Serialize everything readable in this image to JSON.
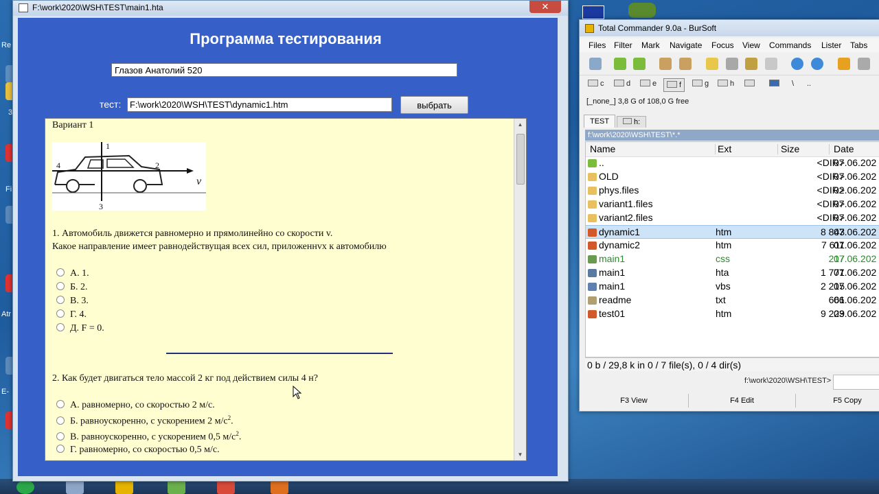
{
  "desktop": {
    "labels": [
      "Re",
      "3",
      "Fi",
      "Atr",
      "E-"
    ]
  },
  "hta_window": {
    "title": "F:\\work\\2020\\WSH\\TEST\\main1.hta",
    "close_label": "✕",
    "app_title": "Программа тестирования",
    "name_value": "Глазов Анатолий 520",
    "test_label": "тест:",
    "test_path": "F:\\work\\2020\\WSH\\TEST\\dynamic1.htm",
    "select_button": "выбрать",
    "test": {
      "variant": "Вариант 1",
      "q1_line1": "1.   Автомобиль движется равномерно и прямолинейно со скорости v.",
      "q1_line2": "Какое направление имеет равнодействущая всех сил, приложеннvх к автомобилю",
      "q1_options": [
        "А. 1.",
        "Б. 2.",
        "В. 3.",
        "Г. 4.",
        "Д. F = 0."
      ],
      "q2": "2.   Как будет двигаться тело массой 2 кг под действием силы 4 н?",
      "q2_options": [
        "А. равномерно, со скоростью 2 м/с.",
        "Б. равноускоренно, с ускорением 2 м/с",
        "В. равноускоренно, с ускорением 0,5 м/с",
        "Г. равномерно, со скоростью 0,5 м/с."
      ],
      "superscript": "2",
      "period": ".",
      "figure_labels": {
        "one": "1",
        "two": "2",
        "three": "3",
        "four": "4",
        "v": "v"
      }
    }
  },
  "total_commander": {
    "title": "Total Commander 9.0a - BurSoft",
    "menu": [
      "Files",
      "Filter",
      "Mark",
      "Navigate",
      "Focus",
      "View",
      "Commands",
      "Lister",
      "Tabs"
    ],
    "drives": [
      "c",
      "d",
      "e",
      "f",
      "g",
      "h",
      "\\",
      ".."
    ],
    "free_info": "[_none_]  3,8 G of 108,0 G free",
    "tabs": [
      "TEST",
      "h:"
    ],
    "path": "f:\\work\\2020\\WSH\\TEST\\*.*",
    "columns": [
      "Name",
      "Ext",
      "Size",
      "Date"
    ],
    "files": [
      {
        "name": "..",
        "ext": "",
        "size": "<DIR>",
        "date": "07.06.202"
      },
      {
        "name": "OLD",
        "ext": "",
        "size": "<DIR>",
        "date": "07.06.202"
      },
      {
        "name": "phys.files",
        "ext": "",
        "size": "<DIR>",
        "date": "02.06.202"
      },
      {
        "name": "variant1.files",
        "ext": "",
        "size": "<DIR>",
        "date": "07.06.202"
      },
      {
        "name": "variant2.files",
        "ext": "",
        "size": "<DIR>",
        "date": "07.06.202"
      },
      {
        "name": "dynamic1",
        "ext": "htm",
        "size": "8 843",
        "date": "07.06.202"
      },
      {
        "name": "dynamic2",
        "ext": "htm",
        "size": "7 611",
        "date": "07.06.202"
      },
      {
        "name": "main1",
        "ext": "css",
        "size": "217",
        "date": "07.06.202"
      },
      {
        "name": "main1",
        "ext": "hta",
        "size": "1 771",
        "date": "07.06.202"
      },
      {
        "name": "main1",
        "ext": "vbs",
        "size": "2 215",
        "date": "07.06.202"
      },
      {
        "name": "readme",
        "ext": "txt",
        "size": "661",
        "date": "06.06.202"
      },
      {
        "name": "test01",
        "ext": "htm",
        "size": "9 229",
        "date": "03.06.202"
      }
    ],
    "status": "0 b / 29,8 k in 0 / 7 file(s), 0 / 4 dir(s)",
    "cmd_path": "f:\\work\\2020\\WSH\\TEST>",
    "fkeys": [
      "F3 View",
      "F4 Edit",
      "F5 Copy"
    ]
  },
  "colors": {
    "hta_bg": "#3660c7",
    "test_bg": "#fffed0",
    "tc_selected": "#cde3f8",
    "css_file": "#2a8a2a"
  }
}
